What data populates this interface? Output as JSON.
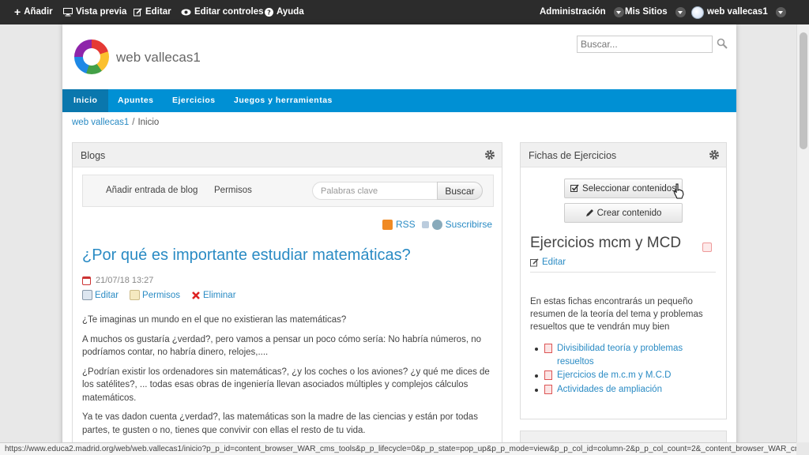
{
  "dockbar": {
    "add": "Añadir",
    "preview": "Vista previa",
    "edit": "Editar",
    "edit_controls": "Editar controles",
    "help": "Ayuda",
    "admin": "Administración",
    "my_sites": "Mis Sitios",
    "user": "web vallecas1"
  },
  "site": {
    "name": "web vallecas1",
    "search_placeholder": "Buscar..."
  },
  "nav": {
    "items": [
      "Inicio",
      "Apuntes",
      "Ejercicios",
      "Juegos y herramientas"
    ],
    "active": "Inicio"
  },
  "breadcrumb": {
    "site": "web vallecas1",
    "separator": "/",
    "current": "Inicio"
  },
  "blogs": {
    "title": "Blogs",
    "add_entry": "Añadir entrada de blog",
    "permissions": "Permisos",
    "keyword_placeholder": "Palabras clave",
    "search_button": "Buscar",
    "rss": "RSS",
    "subscribe": "Suscribirse",
    "post": {
      "title": "¿Por qué es importante estudiar matemáticas?",
      "date": "21/07/18 13:27",
      "actions": [
        "Editar",
        "Permisos",
        "Eliminar"
      ],
      "paragraphs": [
        "¿Te imaginas un mundo en el que no existieran las matemáticas?",
        "A muchos os gustaría ¿verdad?, pero vamos a pensar un poco cómo sería: No habría números, no podríamos contar, no habría dinero, relojes,....",
        "¿Podrían existir los ordenadores sin matemáticas?, ¿y los coches o los aviones? ¿y qué me dices de los satélites?, ... todas esas obras de ingeniería llevan asociados múltiples y complejos cálculos matemáticos.",
        "Ya te vas dadon cuenta ¿verdad?, las matemáticas son la madre de las ciencias y están por todas partes, te gusten o no, tienes que convivir con ellas el resto de tu vida."
      ]
    }
  },
  "fichas": {
    "title": "Fichas de Ejercicios",
    "select_button": "Seleccionar contenidos",
    "create_button": "Crear contenido",
    "content_title": "Ejercicios mcm y MCD",
    "edit": "Editar",
    "description": "En estas fichas encontrarás un pequeño resumen de la teoría del tema y problemas resueltos que te vendrán muy bien",
    "links": [
      "Divisibilidad teoría y problemas resueltos",
      "Ejercicios de m.c.m y M.C.D",
      "Actividades de ampliación"
    ]
  },
  "statusbar": {
    "url": "https://www.educa2.madrid.org/web/web.vallecas1/inicio?p_p_id=content_browser_WAR_cms_tools&p_p_lifecycle=0&p_p_state=pop_up&p_p_mode=view&p_p_col_id=column-2&p_p_col_count=2&_content_browser_WAR_cms_tools..."
  },
  "colors": {
    "dockbar": "#2c2c2c",
    "nav": "#0090d4",
    "nav_active": "#0a77ad",
    "link": "#2a8bc4"
  }
}
